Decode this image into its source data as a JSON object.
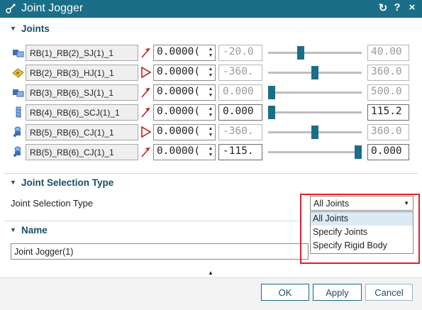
{
  "window": {
    "title": "Joint Jogger",
    "reset_icon": "reset-icon",
    "help_label": "?",
    "close_label": "×"
  },
  "sections": {
    "joints": "Joints",
    "selection_type": "Joint Selection Type",
    "name": "Name"
  },
  "joints": [
    {
      "name": "RB(1)_RB(2)_SJ(1)_1",
      "joint_icon": "slider-joint-icon",
      "type_icon": "linear-motion-icon",
      "value": "0.0000(",
      "min": "-20.0",
      "max": "40.00",
      "slider_fraction": 0.34,
      "min_active": false,
      "max_active": false
    },
    {
      "name": "RB(2)_RB(3)_HJ(1)_1",
      "joint_icon": "hinge-joint-icon",
      "type_icon": "angular-motion-icon",
      "value": "0.0000(",
      "min": "-360.",
      "max": "360.0",
      "slider_fraction": 0.5,
      "min_active": false,
      "max_active": false
    },
    {
      "name": "RB(3)_RB(6)_SJ(1)_1",
      "joint_icon": "slider-joint-icon",
      "type_icon": "linear-motion-icon",
      "value": "0.0000(",
      "min": "0.000",
      "max": "500.0",
      "slider_fraction": 0.0,
      "min_active": false,
      "max_active": false
    },
    {
      "name": "RB(4)_RB(6)_SCJ(1)_1",
      "joint_icon": "screw-joint-icon",
      "type_icon": "linear-motion-icon",
      "value": "0.0000(",
      "min": "0.000",
      "max": "115.2",
      "slider_fraction": 0.0,
      "min_active": true,
      "max_active": true
    },
    {
      "name": "RB(5)_RB(6)_CJ(1)_1",
      "joint_icon": "cylindrical-joint-icon",
      "type_icon": "angular-motion-icon",
      "value": "0.0000(",
      "min": "-360.",
      "max": "360.0",
      "slider_fraction": 0.5,
      "min_active": false,
      "max_active": false
    },
    {
      "name": "RB(5)_RB(6)_CJ(1)_1",
      "joint_icon": "cylindrical-joint-icon",
      "type_icon": "linear-motion-icon",
      "value": "0.0000(",
      "min": "-115.",
      "max": "0.000",
      "slider_fraction": 1.0,
      "min_active": true,
      "max_active": true
    }
  ],
  "selection": {
    "label": "Joint Selection Type",
    "selected": "All Joints",
    "options": [
      "All Joints",
      "Specify Joints",
      "Specify Rigid Body"
    ]
  },
  "name_field": {
    "value": "Joint Jogger(1)"
  },
  "buttons": {
    "ok": "OK",
    "apply": "Apply",
    "cancel": "Cancel"
  },
  "colors": {
    "title_bar": "#1b6e87",
    "accent": "#1a4f66",
    "highlight": "#d9242b"
  }
}
